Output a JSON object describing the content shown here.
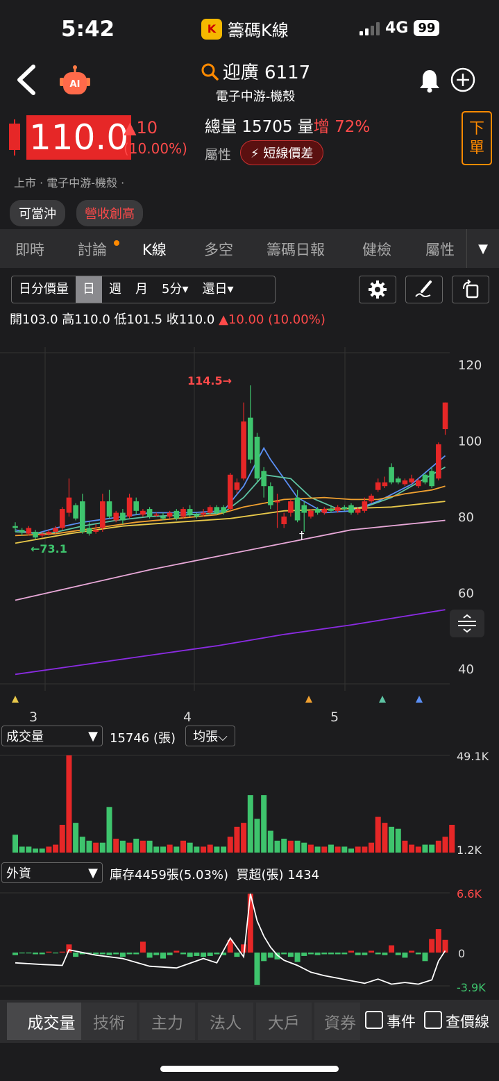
{
  "status_bar": {
    "time": "5:42",
    "app_name": "籌碼K線",
    "network": "4G",
    "battery": "99"
  },
  "header": {
    "title": "迎廣 6117",
    "subtitle": "電子中游-機殼"
  },
  "quote": {
    "price": "110.0",
    "change": "▲10",
    "change_pct": "(10.00%)",
    "volume_label": "總量",
    "volume": "15705",
    "volume_unit": "量",
    "volume_change_label": "增",
    "volume_change_pct": "72%",
    "attr_label": "屬性",
    "attr_badge": "短線價差",
    "order_button": "下單",
    "market_info": "上市 · 電子中游-機殼 ·",
    "tags": [
      "可當沖",
      "營收創高"
    ]
  },
  "tabs": [
    "即時",
    "討論",
    "K線",
    "多空",
    "籌碼日報",
    "健檢",
    "屬性"
  ],
  "active_tab": "K線",
  "chart_toolbar": {
    "periods": [
      "日分價量",
      "日",
      "週",
      "月",
      "5分▾",
      "還日▾"
    ],
    "active_period": "日"
  },
  "ohlc": {
    "open_label": "開",
    "open": "103.0",
    "high_label": "高",
    "high": "110.0",
    "low_label": "低",
    "low": "101.5",
    "close_label": "收",
    "close": "110.0",
    "change": "▲10.00 (10.00%)"
  },
  "chart_data": {
    "type": "candlestick",
    "y_ticks": [
      "120",
      "100",
      "80",
      "60",
      "40"
    ],
    "ylim": [
      36,
      122
    ],
    "x_ticks": [
      "3",
      "4",
      "5"
    ],
    "annotations": {
      "high_mark": "114.5→",
      "low_mark": "←73.1",
      "dagger": "†"
    },
    "candles": [
      [
        77.5,
        77,
        78.5,
        76
      ],
      [
        76.5,
        76,
        77,
        75
      ],
      [
        75.5,
        77,
        77.5,
        75
      ],
      [
        76,
        74.5,
        76.5,
        74
      ],
      [
        75,
        75.5,
        76,
        74.5
      ],
      [
        75.5,
        76,
        76.5,
        75
      ],
      [
        76,
        77,
        77.5,
        75.5
      ],
      [
        77,
        82,
        82.5,
        76.5
      ],
      [
        81,
        85,
        90,
        80
      ],
      [
        83,
        79.5,
        83.5,
        79
      ],
      [
        84,
        76,
        86,
        75.5
      ],
      [
        77,
        75.5,
        78.5,
        75
      ],
      [
        76,
        76.5,
        78,
        75.5
      ],
      [
        77,
        84,
        86,
        76
      ],
      [
        84,
        80,
        87,
        79.5
      ],
      [
        79,
        81,
        81.5,
        78.5
      ],
      [
        81,
        79,
        82,
        78
      ],
      [
        80,
        85,
        86,
        79.5
      ],
      [
        84,
        81.5,
        85,
        80.5
      ],
      [
        80.5,
        81.5,
        82,
        80
      ],
      [
        82,
        80,
        82.5,
        79.5
      ],
      [
        80.5,
        80.5,
        81,
        80
      ],
      [
        80,
        79.5,
        81,
        79
      ],
      [
        80,
        81,
        81.5,
        79.5
      ],
      [
        81.5,
        79.5,
        82,
        79
      ],
      [
        80,
        82,
        82.5,
        79.5
      ],
      [
        82,
        80.5,
        83,
        80
      ],
      [
        80.5,
        80,
        81,
        79.5
      ],
      [
        80.5,
        81,
        82,
        80
      ],
      [
        81,
        82.5,
        83,
        80.5
      ],
      [
        82.5,
        81,
        83,
        80.5
      ],
      [
        82.5,
        81,
        83,
        80.5
      ],
      [
        82,
        91,
        91.5,
        81.5
      ],
      [
        87,
        89,
        90,
        86
      ],
      [
        90,
        105,
        110,
        89.5
      ],
      [
        106,
        95,
        114.5,
        94
      ],
      [
        101,
        90,
        102,
        89
      ],
      [
        92,
        88,
        93,
        85
      ],
      [
        88,
        83,
        89,
        82
      ],
      [
        84,
        84,
        86,
        77
      ],
      [
        78,
        80,
        81,
        77
      ],
      [
        81,
        84,
        84.5,
        80
      ],
      [
        85,
        79,
        87,
        78.5
      ],
      [
        83,
        81,
        84,
        76
      ],
      [
        80,
        81.5,
        82,
        79.5
      ],
      [
        82,
        81,
        82.5,
        80.5
      ],
      [
        81,
        82,
        82.5,
        80.5
      ],
      [
        82,
        81.5,
        83,
        81
      ],
      [
        81.5,
        82.5,
        83,
        81
      ],
      [
        82.5,
        82,
        83,
        81.5
      ],
      [
        83,
        81,
        83.5,
        80.5
      ],
      [
        81,
        82,
        82.5,
        80.5
      ],
      [
        81.5,
        84,
        85,
        81
      ],
      [
        84,
        85.5,
        86,
        83.5
      ],
      [
        87,
        89,
        90,
        86.5
      ],
      [
        88,
        89,
        90.5,
        87.5
      ],
      [
        93,
        89,
        94,
        88.5
      ],
      [
        90,
        89,
        90.5,
        88.5
      ],
      [
        88.5,
        89.5,
        90,
        88
      ],
      [
        89,
        90,
        91,
        88.5
      ],
      [
        88,
        89.5,
        90,
        87.5
      ],
      [
        91,
        89,
        91.5,
        88.5
      ],
      [
        92,
        88,
        93,
        87.5
      ],
      [
        90,
        99,
        99.5,
        89.5
      ],
      [
        103,
        110,
        110,
        101.5
      ]
    ],
    "ma_lines": [
      {
        "color": "#5b8ff5",
        "values": [
          [
            0,
            76.5
          ],
          [
            3,
            75.5
          ],
          [
            6,
            77
          ],
          [
            10,
            78.5
          ],
          [
            14,
            79.5
          ],
          [
            20,
            81
          ],
          [
            26,
            81
          ],
          [
            31,
            81.5
          ],
          [
            34,
            88
          ],
          [
            37,
            98
          ],
          [
            38,
            95
          ],
          [
            42,
            85
          ],
          [
            46,
            81
          ],
          [
            50,
            81.5
          ],
          [
            54,
            84
          ],
          [
            59,
            88.5
          ],
          [
            64,
            96
          ]
        ]
      },
      {
        "color": "#5ec4a4",
        "values": [
          [
            0,
            76
          ],
          [
            5,
            75.5
          ],
          [
            10,
            77.5
          ],
          [
            15,
            79
          ],
          [
            20,
            80
          ],
          [
            26,
            80.5
          ],
          [
            31,
            81
          ],
          [
            34,
            85
          ],
          [
            37,
            91
          ],
          [
            41,
            90
          ],
          [
            44,
            85
          ],
          [
            48,
            82
          ],
          [
            52,
            82.5
          ],
          [
            56,
            85
          ],
          [
            60,
            89
          ],
          [
            64,
            93
          ]
        ]
      },
      {
        "color": "#f0a030",
        "values": [
          [
            0,
            75
          ],
          [
            6,
            75.5
          ],
          [
            12,
            77
          ],
          [
            18,
            78.5
          ],
          [
            24,
            79.5
          ],
          [
            30,
            80.5
          ],
          [
            34,
            82.5
          ],
          [
            40,
            84.5
          ],
          [
            46,
            85
          ],
          [
            50,
            84.5
          ],
          [
            54,
            84.5
          ],
          [
            58,
            86
          ],
          [
            62,
            87
          ],
          [
            64,
            88
          ]
        ]
      },
      {
        "color": "#e8c84a",
        "values": [
          [
            0,
            73
          ],
          [
            8,
            75.5
          ],
          [
            16,
            77.5
          ],
          [
            24,
            78.5
          ],
          [
            32,
            79.5
          ],
          [
            40,
            81.5
          ],
          [
            48,
            82
          ],
          [
            56,
            82.5
          ],
          [
            64,
            84
          ]
        ]
      },
      {
        "color": "#e8a8d8",
        "values": [
          [
            0,
            58
          ],
          [
            10,
            62
          ],
          [
            20,
            66
          ],
          [
            30,
            69.5
          ],
          [
            40,
            73
          ],
          [
            50,
            76.5
          ],
          [
            64,
            79
          ]
        ]
      },
      {
        "color": "#8a2be2",
        "values": [
          [
            0,
            38.5
          ],
          [
            10,
            41
          ],
          [
            20,
            43.5
          ],
          [
            30,
            46
          ],
          [
            40,
            49
          ],
          [
            50,
            51.5
          ],
          [
            64,
            55.5
          ]
        ]
      }
    ]
  },
  "volume_panel": {
    "selector": "成交量",
    "value": "15746 (張)",
    "avg_button": "均張⌵",
    "axis_max": "49.1K",
    "axis_min": "1.2K",
    "values": [
      9,
      3,
      3,
      2,
      2,
      3,
      4,
      14,
      49,
      15,
      8,
      6,
      5,
      5,
      23,
      7,
      6,
      5,
      7,
      6,
      6,
      3,
      3,
      4,
      3,
      6,
      5,
      3,
      3,
      4,
      3,
      3,
      8,
      13,
      15,
      29,
      17,
      29,
      11,
      6,
      7,
      6,
      6,
      5,
      4,
      3,
      3,
      4,
      3,
      3,
      2,
      3,
      3,
      5,
      18,
      15,
      13,
      12,
      6,
      4,
      3,
      4,
      4,
      6,
      8,
      14
    ],
    "colors_up": [
      0,
      0,
      0,
      0,
      0,
      1,
      1,
      1,
      1,
      0,
      0,
      0,
      1,
      0,
      0,
      1,
      0,
      1,
      0,
      1,
      0,
      0,
      0,
      1,
      0,
      1,
      0,
      0,
      1,
      1,
      0,
      0,
      1,
      1,
      1,
      0,
      0,
      0,
      0,
      0,
      0,
      1,
      0,
      0,
      1,
      0,
      1,
      0,
      1,
      0,
      0,
      1,
      1,
      1,
      1,
      1,
      0,
      0,
      1,
      1,
      1,
      0,
      0,
      1,
      1
    ]
  },
  "foreign_panel": {
    "selector": "外資",
    "inventory": "庫存4459張(5.03%)",
    "net_label": "買超(張)",
    "net_value": "1434",
    "axis_max": "6.6K",
    "axis_zero": "0",
    "axis_min": "-3.9K",
    "values": [
      -0.3,
      -0.1,
      -0.1,
      -0.2,
      -0.2,
      0.1,
      -0.1,
      0.1,
      0.9,
      -0.5,
      -0.2,
      -0.1,
      -0.2,
      -0.2,
      -0.3,
      -0.2,
      -0.5,
      -0.2,
      -0.2,
      1.2,
      -0.6,
      -0.3,
      -0.7,
      -0.3,
      0.2,
      -0.2,
      -0.5,
      -0.4,
      -0.5,
      -0.4,
      -0.2,
      -0.3,
      1.4,
      -0.5,
      0.9,
      6.5,
      -3.8,
      -1.0,
      -0.6,
      -0.8,
      -0.2,
      -0.5,
      -1.1,
      -0.4,
      -0.2,
      -0.3,
      -0.2,
      -0.2,
      -0.2,
      -0.2,
      0.2,
      -0.3,
      -0.3,
      0.2,
      -0.2,
      -0.3,
      0.8,
      -0.3,
      -0.6,
      0.2,
      -0.2,
      -1.0,
      1.5,
      2.6,
      1.4
    ],
    "line": [
      [
        0,
        -1.2
      ],
      [
        4,
        -1.4
      ],
      [
        7,
        -1.5
      ],
      [
        8,
        0.3
      ],
      [
        12,
        -0.3
      ],
      [
        16,
        -0.7
      ],
      [
        20,
        -1.6
      ],
      [
        24,
        -1.8
      ],
      [
        28,
        -0.7
      ],
      [
        30,
        -1.2
      ],
      [
        32,
        1.6
      ],
      [
        34,
        -0.5
      ],
      [
        35,
        6.5
      ],
      [
        36,
        3.5
      ],
      [
        37,
        1.8
      ],
      [
        38,
        0.6
      ],
      [
        39,
        -0.3
      ],
      [
        40,
        -0.9
      ],
      [
        42,
        -1.5
      ],
      [
        44,
        -2.3
      ],
      [
        46,
        -2.7
      ],
      [
        48,
        -3.0
      ],
      [
        50,
        -3.3
      ],
      [
        52,
        -3.6
      ],
      [
        54,
        -3.1
      ],
      [
        56,
        -3.7
      ],
      [
        58,
        -3.5
      ],
      [
        60,
        -3.7
      ],
      [
        62,
        -3.2
      ],
      [
        63,
        -1.0
      ],
      [
        64,
        0.2
      ]
    ]
  },
  "bottom_tabs": [
    "成交量",
    "技術",
    "主力",
    "法人",
    "大戶",
    "資券"
  ],
  "bottom_checks": [
    "事件",
    "查價線"
  ]
}
